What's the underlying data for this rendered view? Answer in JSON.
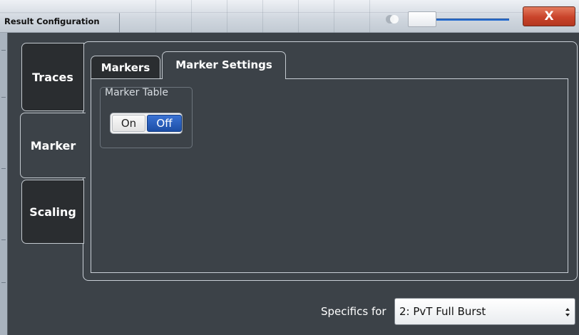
{
  "window": {
    "title": "Result Configuration",
    "close_glyph": "X"
  },
  "vertical_tabs": [
    {
      "label": "Traces",
      "selected": false
    },
    {
      "label": "Marker",
      "selected": true
    },
    {
      "label": "Scaling",
      "selected": false
    }
  ],
  "horizontal_tabs": [
    {
      "label": "Markers",
      "selected": false
    },
    {
      "label": "Marker Settings",
      "selected": true
    }
  ],
  "marker_table": {
    "label": "Marker Table",
    "on_label": "On",
    "off_label": "Off",
    "value": "Off"
  },
  "specifics": {
    "label": "Specifics for",
    "selected": "2: PvT Full Burst"
  },
  "colors": {
    "toggle_active": "#1d4fa6",
    "close_button": "#c9432a",
    "dialog_background": "#3c4248"
  }
}
